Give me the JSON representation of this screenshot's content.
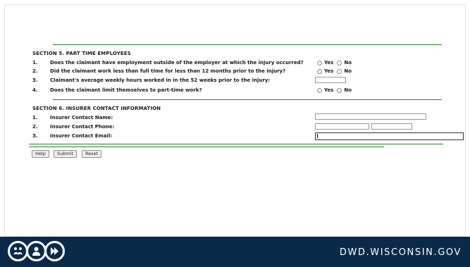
{
  "section5": {
    "title": "SECTION 5.  PART TIME EMPLOYEES",
    "questions": [
      {
        "num": "1.",
        "text": "Does the claimant have employment outside of the employer at which the injury occurred?"
      },
      {
        "num": "2.",
        "text": "Did the claimant work less than full time for less than 12 months prior to the injury?"
      },
      {
        "num": "3.",
        "text": "Claimant's average weekly hours worked in in the 52 weeks prior to the injury:"
      },
      {
        "num": "4.",
        "text": "Does the claimant limit themselves to part-time work?"
      }
    ],
    "yes_label": "Yes",
    "no_label": "No"
  },
  "section6": {
    "title": "SECTION 6.  INSURER CONTACT INFORMATION",
    "fields": [
      {
        "num": "1.",
        "label": "Insurer Contact Name:"
      },
      {
        "num": "2.",
        "label": "Insurer Contact Phone:"
      },
      {
        "num": "3.",
        "label": "Insurer Contact Email:"
      }
    ]
  },
  "buttons": {
    "help": "Help",
    "submit": "Submit",
    "reset": "Reset"
  },
  "footer": {
    "site": "DWD.WISCONSIN.GOV",
    "logo_icons": [
      "people-icon",
      "person-icon",
      "forward-arrows-icon"
    ]
  },
  "colors": {
    "footer_bg": "#0a2a4a",
    "divider_green": "#2e7d32"
  }
}
